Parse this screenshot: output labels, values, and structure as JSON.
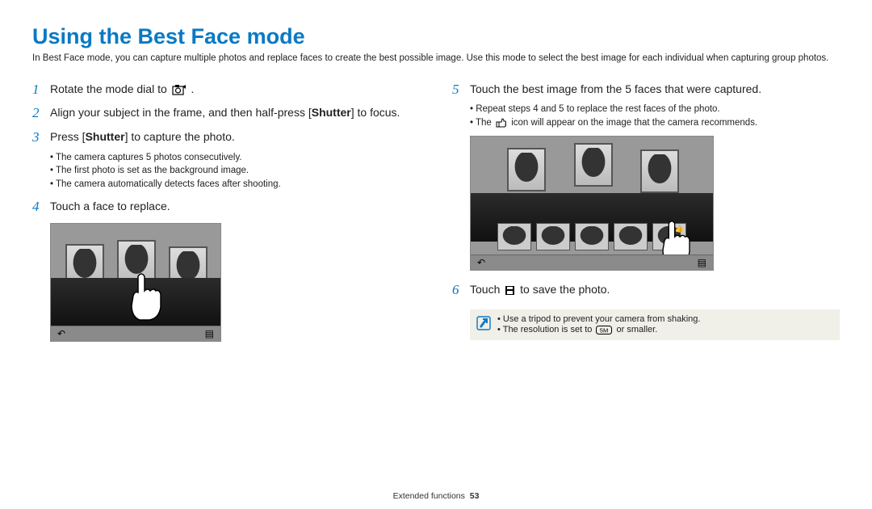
{
  "title": "Using the Best Face mode",
  "intro": "In Best Face mode, you can capture multiple photos and replace faces to create the best possible image. Use this mode to select the best image for each individual when capturing group photos.",
  "left": {
    "step1": {
      "num": "1",
      "start": "Rotate the mode dial to",
      "end": " ."
    },
    "step2": {
      "num": "2",
      "textA": "Align your subject in the frame, and then half-press [",
      "shutter": "Shutter",
      "textB": "] to focus."
    },
    "step3": {
      "num": "3",
      "textA": "Press [",
      "shutter": "Shutter",
      "textB": "] to capture the photo."
    },
    "step3sub": [
      "The camera captures 5 photos consecutively.",
      "The first photo is set as the background image.",
      "The camera automatically detects faces after shooting."
    ],
    "step4": {
      "num": "4",
      "text": "Touch a face to replace."
    }
  },
  "right": {
    "step5": {
      "num": "5",
      "text": "Touch the best image from the 5 faces that were captured."
    },
    "step5sub": {
      "a": "Repeat steps 4 and 5 to replace the rest faces of the photo.",
      "bStart": "The ",
      "bEnd": " icon will appear on the image that the camera recommends."
    },
    "step6": {
      "num": "6",
      "start": "Touch ",
      "end": " to save the photo."
    },
    "note": {
      "a": "Use a tripod to prevent your camera from shaking.",
      "bStart": "The resolution is set to ",
      "bEnd": " or smaller."
    }
  },
  "footer": {
    "section": "Extended functions",
    "page": "53"
  }
}
